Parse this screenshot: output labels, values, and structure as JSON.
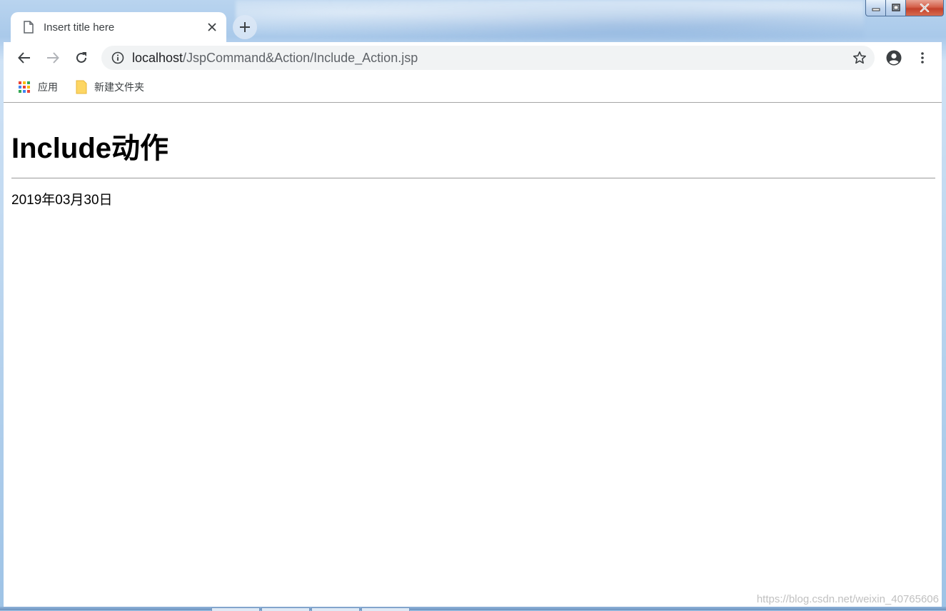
{
  "browser": {
    "tab": {
      "title": "Insert title here"
    },
    "address": {
      "host": "localhost",
      "path": "/JspCommand&Action/Include_Action.jsp"
    },
    "bookmarks": [
      {
        "label": "应用",
        "icon": "apps-grid-icon"
      },
      {
        "label": "新建文件夹",
        "icon": "folder-icon"
      }
    ]
  },
  "page": {
    "heading": "Include动作",
    "date": "2019年03月30日"
  },
  "watermark": "https://blog.csdn.net/weixin_40765606",
  "colors": {
    "tab_text": "#3c4043",
    "omnibox_bg": "#f1f3f4",
    "close_button": "#c3412b"
  }
}
